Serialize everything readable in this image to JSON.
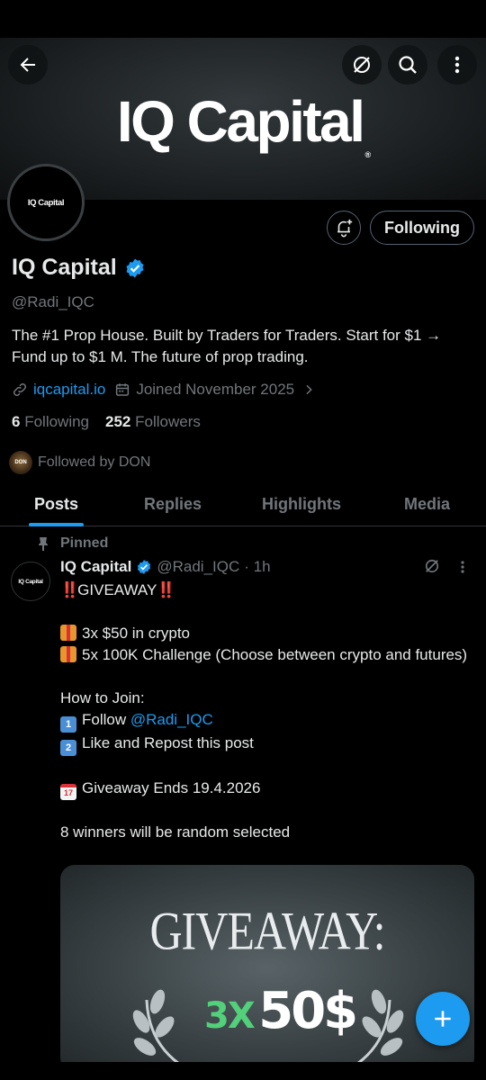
{
  "banner": {
    "title": "IQ Capital",
    "mark": "®"
  },
  "header": {
    "back_icon": "arrow-left-icon",
    "grok_icon": "grok-icon",
    "search_icon": "search-icon",
    "more_icon": "more-vertical-icon"
  },
  "profile": {
    "avatar_text": "IQ Capital",
    "name": "IQ Capital",
    "handle": "@Radi_IQC",
    "bio": "The #1 Prop House. Built by Traders for Traders.  Start for $1 → Fund up to $1 M.  The future of prop trading.",
    "website": "iqcapital.io",
    "joined": "Joined November 2025",
    "following_count": "6",
    "following_label": "Following",
    "followers_count": "252",
    "followers_label": "Followers",
    "followed_by": "Followed by DON",
    "followed_by_avatar": "DON",
    "follow_button": "Following"
  },
  "tabs": [
    {
      "label": "Posts",
      "active": true
    },
    {
      "label": "Replies",
      "active": false
    },
    {
      "label": "Highlights",
      "active": false
    },
    {
      "label": "Media",
      "active": false
    }
  ],
  "post": {
    "pinned_label": "Pinned",
    "avatar_text": "IQ Capital",
    "name": "IQ Capital",
    "handle": "@Radi_IQC",
    "time": "· 1h",
    "headline_marks": "‼️",
    "headline": "GIVEAWAY",
    "line1": "3x $50 in crypto",
    "line2": "5x 100K Challenge (Choose between crypto and futures)",
    "howto": "How to Join:",
    "step1_prefix": "Follow ",
    "step1_mention": "@Radi_IQC",
    "step2": "Like and Repost this post",
    "ends": "Giveaway Ends 19.4.2026",
    "winners": "8 winners will be random selected",
    "step1_num": "1",
    "step2_num": "2",
    "cal_num": "17",
    "media": {
      "title": "GIVEAWAY:",
      "amount_prefix": "3X",
      "amount": "50$"
    }
  },
  "colors": {
    "accent": "#1d9bf0",
    "muted": "#71767b",
    "text": "#e7e9ea",
    "bg": "#000000"
  }
}
